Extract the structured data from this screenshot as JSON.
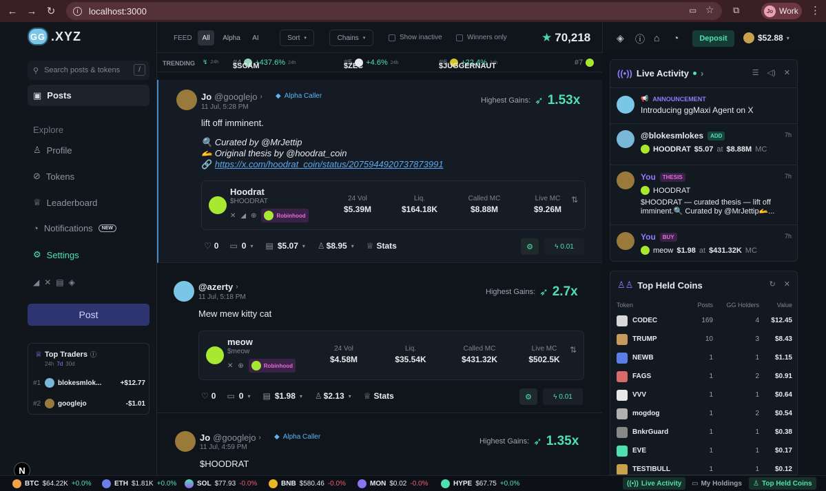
{
  "browser": {
    "url": "localhost:3000",
    "profile_initials": "Jo",
    "profile_label": "Work"
  },
  "sidebar": {
    "logo_text": ".XYZ",
    "logo_mark": "GG",
    "search_placeholder": "Search posts & tokens",
    "search_kbd": "/",
    "posts_label": "Posts",
    "explore_label": "Explore",
    "nav": [
      {
        "label": "Profile"
      },
      {
        "label": "Tokens"
      },
      {
        "label": "Leaderboard"
      },
      {
        "label": "Notifications",
        "badge": "NEW"
      },
      {
        "label": "Settings"
      }
    ],
    "post_button": "Post",
    "top_traders": {
      "title": "Top Traders",
      "periods": [
        "24h",
        "7d",
        "30d"
      ],
      "active_period": "7d",
      "rows": [
        {
          "rank": "#1",
          "name": "blokesmlok...",
          "pnl": "+$12.77"
        },
        {
          "rank": "#2",
          "name": "googlejo",
          "pnl": "-$1.01"
        }
      ]
    },
    "n_badge": "N"
  },
  "feedbar": {
    "feed_label": "FEED",
    "tabs": [
      "All",
      "Alpha",
      "AI"
    ],
    "active_tab": "All",
    "sort_label": "Sort",
    "chains_label": "Chains",
    "show_inactive": "Show inactive",
    "winners_only": "Winners only",
    "points": "70,218"
  },
  "trending": {
    "label": "TRENDING",
    "items": [
      {
        "rank": "",
        "ticker": "",
        "pct": "",
        "time": "24h"
      },
      {
        "rank": "#4",
        "ticker": "$SCAM",
        "pct": "+437.6%",
        "time": "24h"
      },
      {
        "rank": "#5",
        "ticker": "$ZEC",
        "pct": "+4.6%",
        "time": "24h"
      },
      {
        "rank": "#6",
        "ticker": "$JUGGERNAUT",
        "pct": "+22.4%",
        "time": "24h"
      },
      {
        "rank": "#7",
        "ticker": "",
        "pct": "",
        "time": ""
      }
    ]
  },
  "posts": [
    {
      "name": "Jo",
      "handle": "@googlejo",
      "badge": "Alpha Caller",
      "time": "11 Jul, 5:28 PM",
      "gains_label": "Highest Gains:",
      "gains": "1.53x",
      "line1": "lift off imminent.",
      "line2": "Curated by @MrJettip",
      "line3": "Original thesis by @hoodrat_coin",
      "link": "https://x.com/hoodrat_coin/status/2075944920737873991",
      "token": {
        "name": "Hoodrat",
        "symbol": "$HOODRAT",
        "venue": "Robinhood",
        "vol_l": "24 Vol",
        "vol": "$5.39M",
        "liq_l": "Liq.",
        "liq": "$164.18K",
        "cmc_l": "Called MC",
        "cmc": "$8.88M",
        "lmc_l": "Live MC",
        "lmc": "$9.26M"
      },
      "likes": "0",
      "comments": "0",
      "price": "$5.07",
      "holder": "$8.95",
      "stats": "Stats",
      "zap": "0.01"
    },
    {
      "name": "@azerty",
      "handle": "",
      "badge": "",
      "time": "11 Jul, 5:18 PM",
      "gains_label": "Highest Gains:",
      "gains": "2.7x",
      "line1": "Mew mew kitty cat",
      "token": {
        "name": "meow",
        "symbol": "$meow",
        "venue": "Robinhood",
        "vol_l": "24 Vol",
        "vol": "$4.58M",
        "liq_l": "Liq.",
        "liq": "$35.54K",
        "cmc_l": "Called MC",
        "cmc": "$431.32K",
        "lmc_l": "Live MC",
        "lmc": "$502.5K"
      },
      "likes": "0",
      "comments": "0",
      "price": "$1.98",
      "holder": "$2.13",
      "stats": "Stats",
      "zap": "0.01"
    },
    {
      "name": "Jo",
      "handle": "@googlejo",
      "badge": "Alpha Caller",
      "time": "11 Jul, 4:59 PM",
      "gains_label": "Highest Gains:",
      "gains": "1.35x",
      "line1": "$HOODRAT"
    }
  ],
  "header_right": {
    "deposit": "Deposit",
    "balance": "$52.88"
  },
  "live_activity": {
    "title": "Live Activity",
    "announcement": {
      "tag": "ANNOUNCEMENT",
      "text": "Introducing ggMaxi Agent on X"
    },
    "rows": [
      {
        "name": "@blokesmlokes",
        "tag": "ADD",
        "time": "7h",
        "token": "HOODRAT",
        "price": "$5.07",
        "at": "at",
        "mc": "$8.88M",
        "mc_l": "MC"
      },
      {
        "name": "You",
        "tag": "THESIS",
        "time": "7h",
        "token": "HOODRAT",
        "text": "$HOODRAT — curated thesis — lift off imminent.🔍 Curated by @MrJettip🫴..."
      },
      {
        "name": "You",
        "tag": "BUY",
        "time": "7h",
        "token": "meow",
        "price": "$1.98",
        "at": "at",
        "mc": "$431.32K",
        "mc_l": "MC"
      }
    ]
  },
  "top_held": {
    "title": "Top Held Coins",
    "cols": [
      "Token",
      "Posts",
      "GG Holders",
      "Value"
    ],
    "rows": [
      {
        "n": "CODEC",
        "p": "169",
        "h": "4",
        "v": "$12.45"
      },
      {
        "n": "TRUMP",
        "p": "10",
        "h": "3",
        "v": "$8.43"
      },
      {
        "n": "NEWB",
        "p": "1",
        "h": "1",
        "v": "$1.15"
      },
      {
        "n": "FAGS",
        "p": "1",
        "h": "2",
        "v": "$0.91"
      },
      {
        "n": "VVV",
        "p": "1",
        "h": "1",
        "v": "$0.64"
      },
      {
        "n": "mogdog",
        "p": "1",
        "h": "2",
        "v": "$0.54"
      },
      {
        "n": "BnkrGuard",
        "p": "1",
        "h": "1",
        "v": "$0.38"
      },
      {
        "n": "EVE",
        "p": "1",
        "h": "1",
        "v": "$0.17"
      },
      {
        "n": "TESTIBULL",
        "p": "1",
        "h": "1",
        "v": "$0.12"
      }
    ]
  },
  "ticker": [
    {
      "s": "BTC",
      "p": "$64.22K",
      "c": "+0.0%"
    },
    {
      "s": "ETH",
      "p": "$1.81K",
      "c": "+0.0%"
    },
    {
      "s": "SOL",
      "p": "$77.93",
      "c": "-0.0%"
    },
    {
      "s": "BNB",
      "p": "$580.46",
      "c": "-0.0%"
    },
    {
      "s": "MON",
      "p": "$0.02",
      "c": "-0.0%"
    },
    {
      "s": "HYPE",
      "p": "$67.75",
      "c": "+0.0%"
    }
  ],
  "bottom_tabs": [
    "Live Activity",
    "My Holdings",
    "Top Held Coins"
  ]
}
